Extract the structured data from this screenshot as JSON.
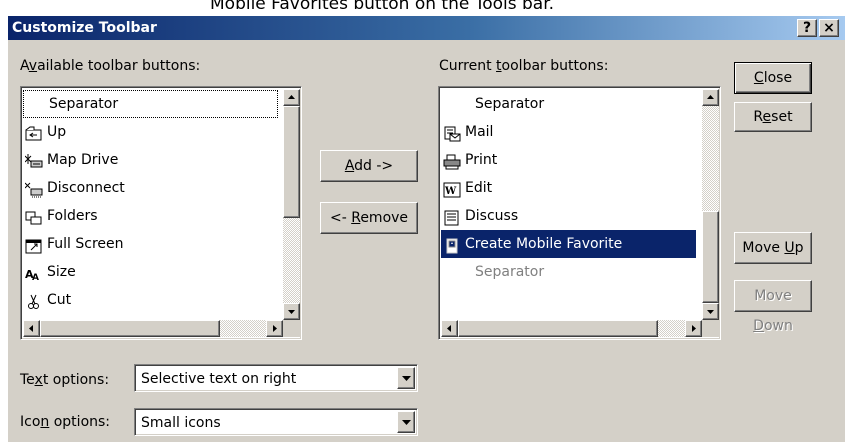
{
  "page_caption": "Mobile Favorites button on the Tools bar.",
  "dialog": {
    "title": "Customize Toolbar",
    "help_label": "?",
    "close_label": "×"
  },
  "available": {
    "label_pre": "A",
    "label_ul": "v",
    "label_post": "ailable toolbar buttons:",
    "items": [
      {
        "label": "Separator",
        "icon": "none"
      },
      {
        "label": "Up",
        "icon": "up-folder-icon"
      },
      {
        "label": "Map Drive",
        "icon": "map-drive-icon"
      },
      {
        "label": "Disconnect",
        "icon": "disconnect-icon"
      },
      {
        "label": "Folders",
        "icon": "folders-icon"
      },
      {
        "label": "Full Screen",
        "icon": "full-screen-icon"
      },
      {
        "label": "Size",
        "icon": "size-icon"
      },
      {
        "label": "Cut",
        "icon": "scissors-icon"
      }
    ]
  },
  "current": {
    "label_pre": "Current ",
    "label_ul": "t",
    "label_post": "oolbar buttons:",
    "items": [
      {
        "label": "Separator",
        "icon": "none"
      },
      {
        "label": "Mail",
        "icon": "mail-icon"
      },
      {
        "label": "Print",
        "icon": "printer-icon"
      },
      {
        "label": "Edit",
        "icon": "edit-icon"
      },
      {
        "label": "Discuss",
        "icon": "discuss-icon"
      },
      {
        "label": "Create Mobile Favorite",
        "icon": "mobile-favorite-icon",
        "selected": true
      },
      {
        "label": "Separator",
        "icon": "none",
        "disabled": true
      }
    ]
  },
  "buttons": {
    "add_ul": "A",
    "add_post": "dd ->",
    "remove_pre": "<- ",
    "remove_ul": "R",
    "remove_post": "emove",
    "close_ul": "C",
    "close_post": "lose",
    "reset_pre": "R",
    "reset_ul": "e",
    "reset_post": "set",
    "moveup_pre": "Move ",
    "moveup_ul": "U",
    "moveup_post": "p",
    "movedown_pre": "Move ",
    "movedown_ul": "D",
    "movedown_post": "own"
  },
  "text_options": {
    "label_pre": "Te",
    "label_ul": "x",
    "label_post": "t options:",
    "value": "Selective text on right"
  },
  "icon_options": {
    "label_pre": "Ico",
    "label_ul": "n",
    "label_post": " options:",
    "value": "Small icons"
  },
  "colors": {
    "selection": "#0a246a",
    "face": "#d4d0c8",
    "disabled_text": "#808080"
  }
}
